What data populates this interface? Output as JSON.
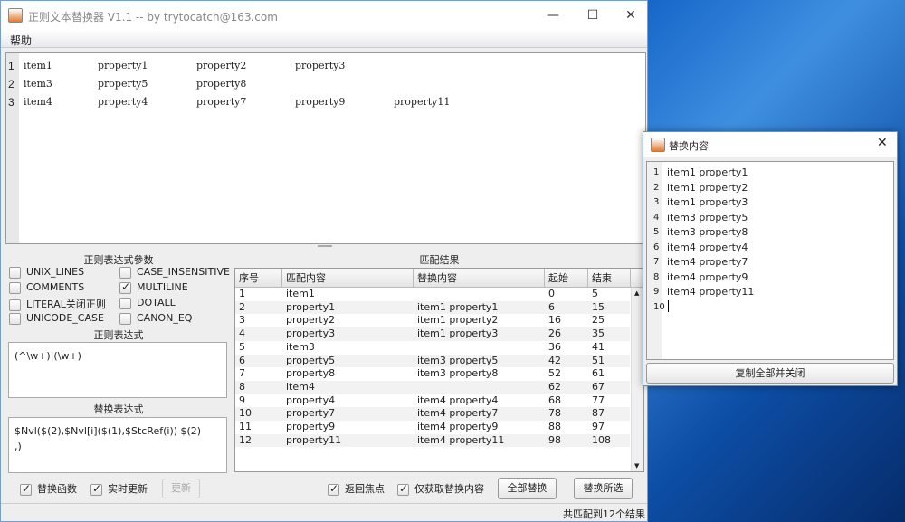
{
  "main_window": {
    "title": "正则文本替换器 V1.1 -- by trytocatch@163.com",
    "controls": {
      "minimize": "—",
      "maximize": "☐",
      "close": "✕"
    },
    "menu": [
      "帮助"
    ]
  },
  "editor": {
    "lines": [
      {
        "num": "1",
        "tokens": [
          "item1",
          "property1",
          "property2",
          "property3"
        ]
      },
      {
        "num": "2",
        "tokens": [
          "item3",
          "property5",
          "property8"
        ]
      },
      {
        "num": "3",
        "tokens": [
          "item4",
          "property4",
          "property7",
          "property9",
          "property11"
        ]
      }
    ]
  },
  "options": {
    "heading": "正则表达式參数",
    "items": [
      {
        "label": "UNIX_LINES",
        "checked": false
      },
      {
        "label": "CASE_INSENSITIVE",
        "checked": false
      },
      {
        "label": "COMMENTS",
        "checked": false
      },
      {
        "label": "MULTILINE",
        "checked": true
      },
      {
        "label": "LITERAL关闭正则",
        "checked": false
      },
      {
        "label": "DOTALL",
        "checked": false
      },
      {
        "label": "UNICODE_CASE",
        "checked": false
      },
      {
        "label": "CANON_EQ",
        "checked": false
      }
    ]
  },
  "regex": {
    "heading": "正则表达式",
    "value": "(^\\w+)|(\\w+)"
  },
  "replace": {
    "heading": "替换表达式",
    "line1": "$Nvl($(2),$Nvl[i]($(1),$StcRef(i))  $(2)",
    "line2": ",)"
  },
  "bottom_left": {
    "replace_func": {
      "label": "替换函数",
      "checked": true
    },
    "realtime": {
      "label": "实时更新",
      "checked": true
    },
    "update_button": "更新"
  },
  "results": {
    "heading": "匹配结果",
    "columns": [
      "序号",
      "匹配内容",
      "替换内容",
      "起始",
      "结束"
    ],
    "rows": [
      [
        "1",
        "item1",
        "",
        "0",
        "5"
      ],
      [
        "2",
        "property1",
        "item1  property1",
        "6",
        "15"
      ],
      [
        "3",
        "property2",
        "item1  property2",
        "16",
        "25"
      ],
      [
        "4",
        "property3",
        "item1  property3",
        "26",
        "35"
      ],
      [
        "5",
        "item3",
        "",
        "36",
        "41"
      ],
      [
        "6",
        "property5",
        "item3  property5",
        "42",
        "51"
      ],
      [
        "7",
        "property8",
        "item3  property8",
        "52",
        "61"
      ],
      [
        "8",
        "item4",
        "",
        "62",
        "67"
      ],
      [
        "9",
        "property4",
        "item4  property4",
        "68",
        "77"
      ],
      [
        "10",
        "property7",
        "item4  property7",
        "78",
        "87"
      ],
      [
        "11",
        "property9",
        "item4  property9",
        "88",
        "97"
      ],
      [
        "12",
        "property11",
        "item4  property11",
        "98",
        "108"
      ]
    ]
  },
  "bottom_right": {
    "return_focus": {
      "label": "返回焦点",
      "checked": true
    },
    "only_replace": {
      "label": "仅获取替换内容",
      "checked": true
    },
    "replace_all": "全部替换",
    "replace_selected": "替换所选"
  },
  "status": "共匹配到12个结果",
  "dialog": {
    "title": "替换内容",
    "close": "✕",
    "lines": [
      "item1  property1",
      "item1  property2",
      "item1  property3",
      "item3  property5",
      "item3  property8",
      "item4  property4",
      "item4  property7",
      "item4  property9",
      "item4  property11",
      ""
    ],
    "button": "复制全部并关闭"
  }
}
